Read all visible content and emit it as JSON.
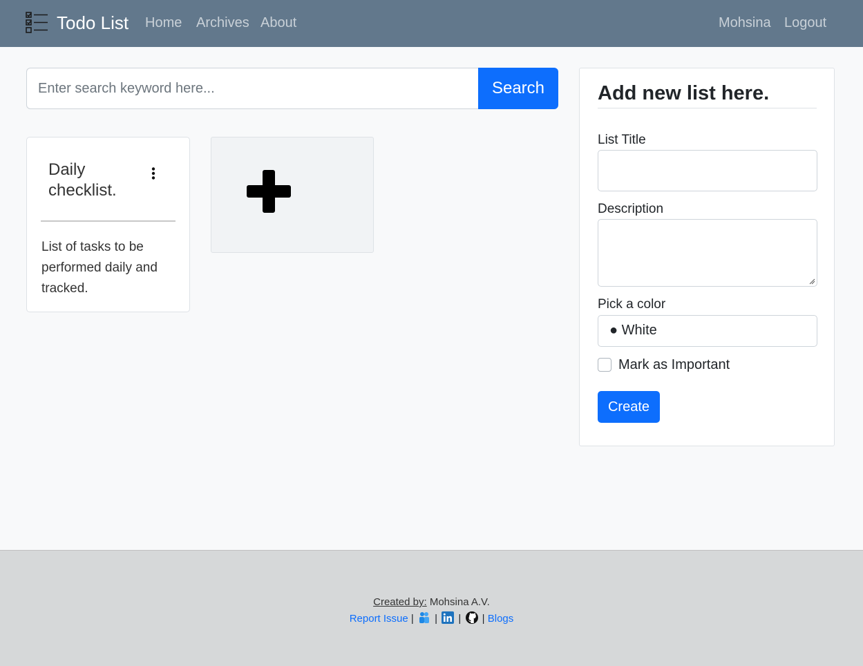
{
  "navbar": {
    "brand_icon": "checklist-icon",
    "brand": "Todo List",
    "links": [
      "Home",
      "Archives",
      "About"
    ],
    "user": "Mohsina",
    "logout": "Logout"
  },
  "search": {
    "placeholder": "Enter search keyword here...",
    "button": "Search"
  },
  "lists": [
    {
      "title": "Daily checklist.",
      "description": "List of tasks to be performed daily and tracked.",
      "menu_icon": "kebab-menu-icon"
    }
  ],
  "add_card": {
    "icon": "plus-icon"
  },
  "form": {
    "heading": "Add new list here.",
    "title_label": "List Title",
    "title_value": "",
    "description_label": "Description",
    "description_value": "",
    "color_label": "Pick a color",
    "color_selected": "● White",
    "important_label": "Mark as Important",
    "important_checked": false,
    "create_button": "Create"
  },
  "footer": {
    "created_by_label": "Created by:",
    "author": "Mohsina A.V.",
    "report_link": "Report Issue",
    "separator": "|",
    "icons": [
      "community-icon",
      "linkedin-icon",
      "github-icon"
    ],
    "blogs_link": "Blogs"
  },
  "colors": {
    "navbar_bg": "#62788c",
    "primary": "#0d6efd",
    "page_bg": "#f8f9fa",
    "footer_bg": "#d6d8d9"
  }
}
